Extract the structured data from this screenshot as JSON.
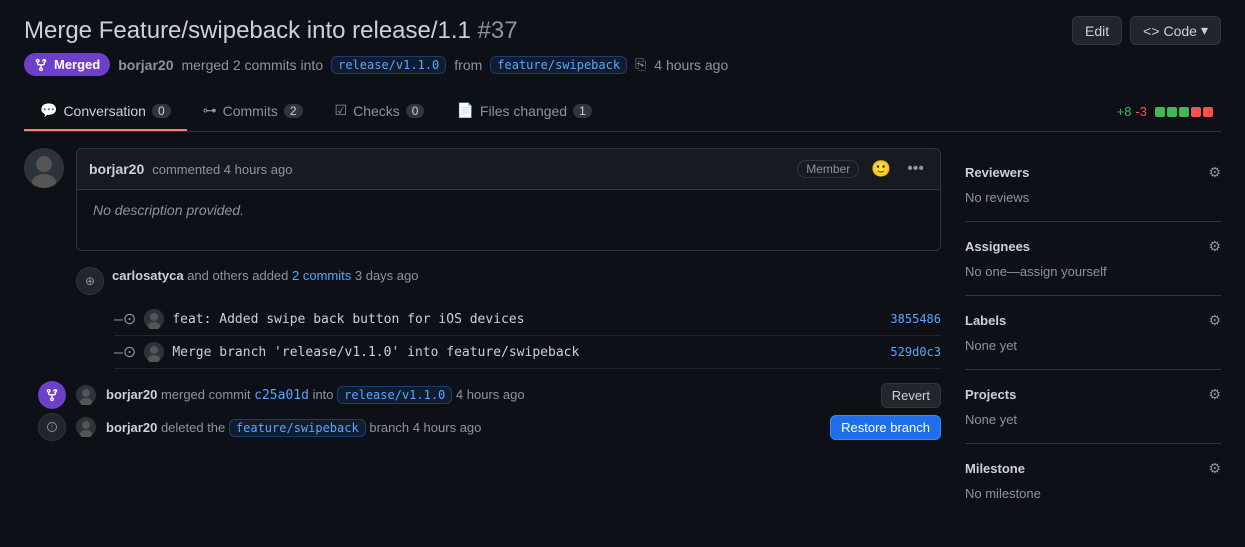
{
  "pr": {
    "title": "Merge Feature/swipeback into release/1.1",
    "number": "#37",
    "status": "Merged",
    "author": "borjar20",
    "commits_count": "2",
    "target_branch": "release/v1.1.0",
    "source_branch": "feature/swipeback",
    "time_ago": "4 hours ago",
    "diff_plus": "+8",
    "diff_minus": "-3"
  },
  "tabs": {
    "conversation": {
      "label": "Conversation",
      "count": "0"
    },
    "commits": {
      "label": "Commits",
      "count": "2"
    },
    "checks": {
      "label": "Checks",
      "count": "0"
    },
    "files_changed": {
      "label": "Files changed",
      "count": "1"
    }
  },
  "buttons": {
    "edit": "Edit",
    "code": "Code",
    "revert": "Revert",
    "restore_branch": "Restore branch"
  },
  "comment": {
    "author": "borjar20",
    "time": "commented 4 hours ago",
    "badge": "Member",
    "body": "No description provided."
  },
  "timeline": {
    "added_by": "carlosatyca",
    "added_text": "and others added",
    "added_commits": "2 commits",
    "added_when": "3 days ago"
  },
  "commits": [
    {
      "message": "feat: Added swipe back button for iOS devices",
      "hash": "3855486"
    },
    {
      "message": "Merge branch 'release/v1.1.0' into feature/swipeback",
      "hash": "529d0c3"
    }
  ],
  "merge_event": {
    "author": "borjar20",
    "action": "merged commit",
    "commit_ref": "c25a01d",
    "into_text": "into",
    "branch": "release/v1.1.0",
    "time": "4 hours ago"
  },
  "delete_event": {
    "author": "borjar20",
    "action": "deleted the",
    "branch": "feature/swipeback",
    "text": "branch",
    "time": "4 hours ago"
  },
  "sidebar": {
    "reviewers": {
      "title": "Reviewers",
      "value": "No reviews"
    },
    "assignees": {
      "title": "Assignees",
      "value": "No one—assign yourself"
    },
    "labels": {
      "title": "Labels",
      "value": "None yet"
    },
    "projects": {
      "title": "Projects",
      "value": "None yet"
    },
    "milestone": {
      "title": "Milestone",
      "value": "No milestone"
    }
  },
  "diff_blocks": [
    "#3fb950",
    "#3fb950",
    "#3fb950",
    "#f85149",
    "#f85149"
  ]
}
